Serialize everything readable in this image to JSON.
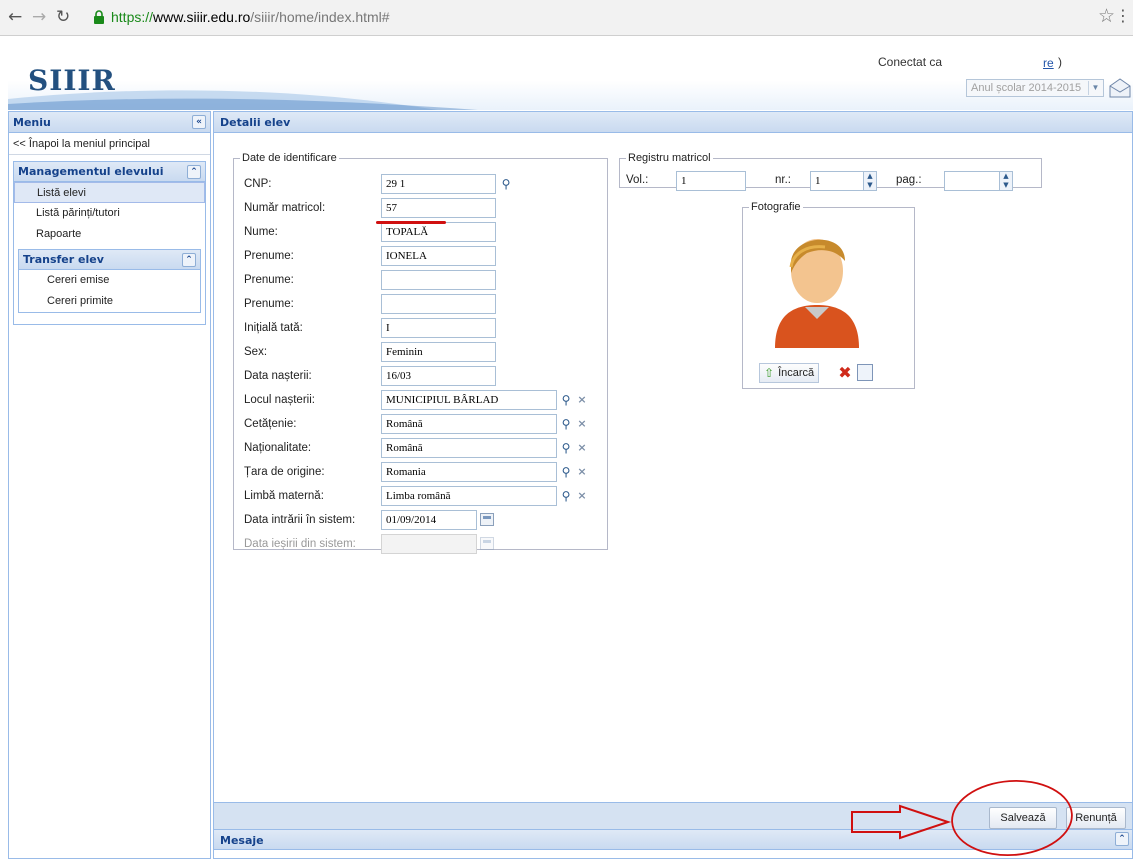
{
  "browser": {
    "back_icon": "back-arrow-icon",
    "url_scheme": "https://",
    "url_host": "www.siiir.edu.ro",
    "url_path": "/siiir/home/index.html#"
  },
  "header": {
    "logo": "SIIIR",
    "connected_label": "Conectat ca",
    "user_link": "re",
    "user_paren": ")",
    "school_year": "Anul școlar 2014-2015"
  },
  "menu": {
    "title": "Meniu",
    "back_main": "<< Înapoi la meniul principal",
    "management": {
      "title": "Managementul elevului",
      "items": [
        "Listă elevi",
        "Listă părinți/tutori",
        "Rapoarte"
      ],
      "selected": "Listă elevi"
    },
    "transfer": {
      "title": "Transfer elev",
      "items": [
        "Cereri emise",
        "Cereri primite"
      ]
    }
  },
  "main": {
    "title": "Detalii elev",
    "identification": {
      "legend": "Date de identificare",
      "fields": [
        {
          "label": "CNP:",
          "value": "29          1"
        },
        {
          "label": "Număr matricol:",
          "value": "57"
        },
        {
          "label": "Nume:",
          "value": "TOPALĂ"
        },
        {
          "label": "Prenume:",
          "value": "IONELA"
        },
        {
          "label": "Prenume:",
          "value": ""
        },
        {
          "label": "Prenume:",
          "value": ""
        },
        {
          "label": "Inițială tată:",
          "value": "I"
        },
        {
          "label": "Sex:",
          "value": "Feminin"
        },
        {
          "label": "Data nașterii:",
          "value": "16/03"
        },
        {
          "label": "Locul nașterii:",
          "value": "MUNICIPIUL BÂRLAD"
        },
        {
          "label": "Cetățenie:",
          "value": "Română"
        },
        {
          "label": "Naționalitate:",
          "value": "Română"
        },
        {
          "label": "Țara de origine:",
          "value": "Romania"
        },
        {
          "label": "Limbă maternă:",
          "value": "Limba română"
        },
        {
          "label": "Data intrării în sistem:",
          "value": "01/09/2014"
        },
        {
          "label": "Data ieșirii din sistem:",
          "value": ""
        }
      ]
    },
    "registry": {
      "legend": "Registru matricol",
      "vol_label": "Vol.:",
      "vol_value": "1",
      "nr_label": "nr.:",
      "nr_value": "1",
      "pag_label": "pag.:",
      "pag_value": ""
    },
    "photo": {
      "legend": "Fotografie",
      "upload_label": "Încarcă"
    },
    "save_label": "Salvează",
    "cancel_label": "Renunță"
  },
  "messages": {
    "title": "Mesaje"
  },
  "colors": {
    "panel_header": "#c9daf0",
    "border": "#99bbe8",
    "annotation": "#d01010"
  }
}
